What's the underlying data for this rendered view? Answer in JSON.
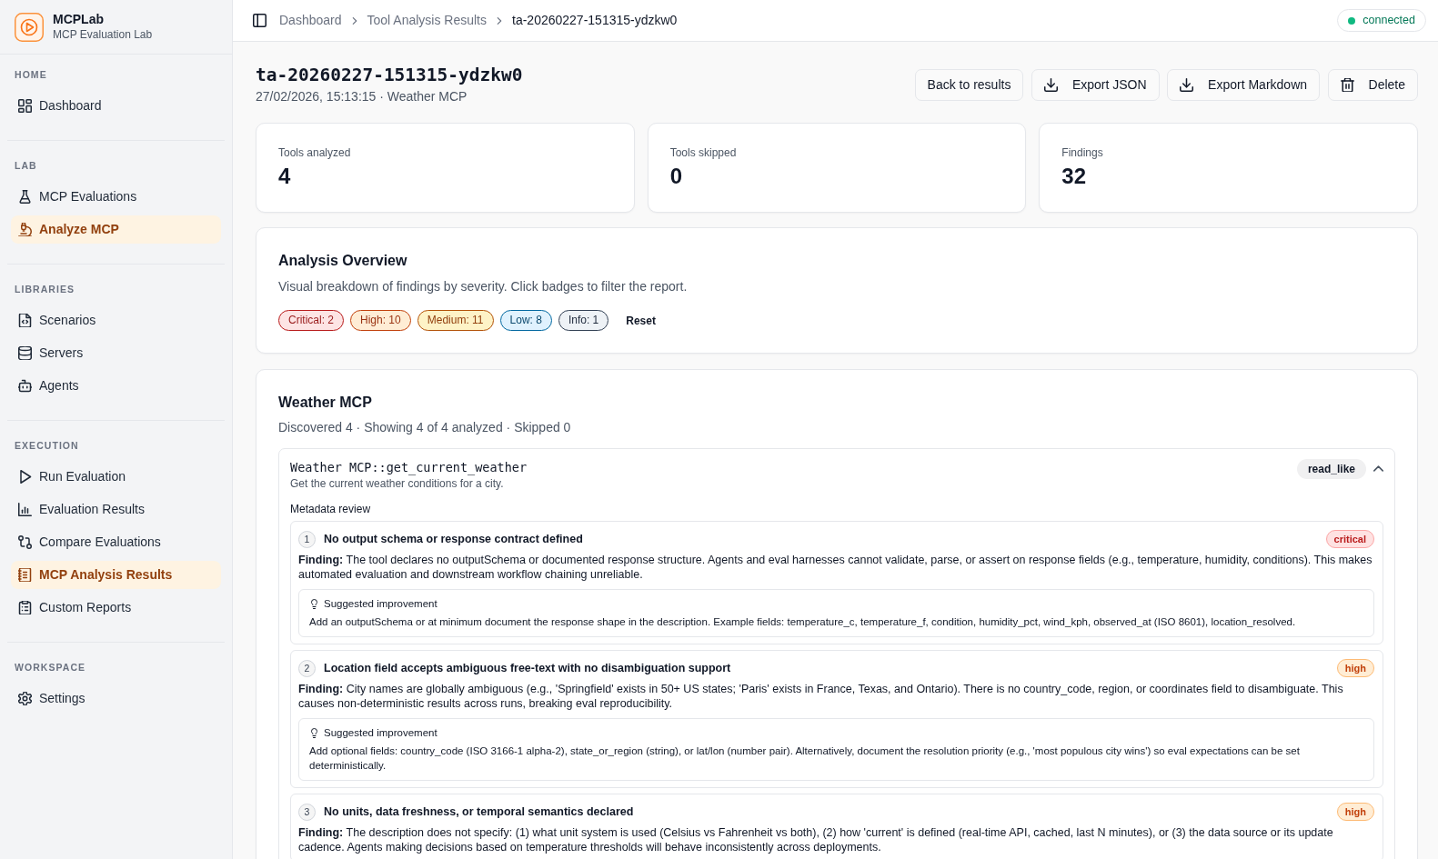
{
  "sidebar": {
    "brand": {
      "name": "MCPLab",
      "subtitle": "MCP Evaluation Lab"
    },
    "sections": [
      {
        "title": "HOME",
        "items": [
          {
            "label": "Dashboard",
            "selected": false
          }
        ]
      },
      {
        "title": "LAB",
        "items": [
          {
            "label": "MCP Evaluations",
            "selected": false
          },
          {
            "label": "Analyze MCP",
            "selected": true
          }
        ]
      },
      {
        "title": "LIBRARIES",
        "items": [
          {
            "label": "Scenarios",
            "selected": false
          },
          {
            "label": "Servers",
            "selected": false
          },
          {
            "label": "Agents",
            "selected": false
          }
        ]
      },
      {
        "title": "EXECUTION",
        "items": [
          {
            "label": "Run Evaluation",
            "selected": false
          },
          {
            "label": "Evaluation Results",
            "selected": false
          },
          {
            "label": "Compare Evaluations",
            "selected": false
          },
          {
            "label": "MCP Analysis Results",
            "selected": true
          },
          {
            "label": "Custom Reports",
            "selected": false
          }
        ]
      },
      {
        "title": "WORKSPACE",
        "items": [
          {
            "label": "Settings",
            "selected": false
          }
        ]
      }
    ]
  },
  "header": {
    "breadcrumbs": [
      {
        "label": "Dashboard",
        "current": false
      },
      {
        "label": "Tool Analysis Results",
        "current": false
      },
      {
        "label": "ta-20260227-151315-ydzkw0",
        "current": true
      }
    ],
    "status": {
      "label": "connected",
      "color": "#10b981"
    }
  },
  "page": {
    "title": "ta-20260227-151315-ydzkw0",
    "subtitle": "27/02/2026, 15:13:15 · Weather MCP",
    "actions": [
      {
        "label": "Back to results"
      },
      {
        "label": "Export JSON"
      },
      {
        "label": "Export Markdown"
      },
      {
        "label": "Delete"
      }
    ]
  },
  "stats": [
    {
      "label": "Tools analyzed",
      "value": "4"
    },
    {
      "label": "Tools skipped",
      "value": "0"
    },
    {
      "label": "Findings",
      "value": "32"
    }
  ],
  "overview": {
    "title": "Analysis Overview",
    "description": "Visual breakdown of findings by severity. Click badges to filter the report.",
    "filters": [
      {
        "label": "Critical: 2",
        "kind": "critical"
      },
      {
        "label": "High: 10",
        "kind": "high"
      },
      {
        "label": "Medium: 11",
        "kind": "medium"
      },
      {
        "label": "Low: 8",
        "kind": "low"
      },
      {
        "label": "Info: 1",
        "kind": "info"
      }
    ],
    "reset": "Reset"
  },
  "server": {
    "title": "Weather MCP",
    "summary": "Discovered 4 · Showing 4 of 4 analyzed · Skipped 0",
    "tools": [
      {
        "name": "Weather MCP::get_current_weather",
        "description": "Get the current weather conditions for a city.",
        "tag": "read_like",
        "expanded": true,
        "review_title": "Metadata review",
        "findings": [
          {
            "number": "1",
            "title": "No output schema or response contract defined",
            "badge": "critical",
            "kind": "critical",
            "text": "**Finding:** The tool declares no outputSchema or documented response structure. Agents and eval harnesses cannot validate, parse, or assert on response fields (e.g., temperature, humidity, conditions). This makes automated evaluation and downstream workflow chaining unreliable.",
            "suggestion": {
              "title": "Suggested improvement",
              "text": "Add an outputSchema or at minimum document the response shape in the description. Example fields: temperature_c, temperature_f, condition, humidity_pct, wind_kph, observed_at (ISO 8601), location_resolved."
            }
          },
          {
            "number": "2",
            "title": "Location field accepts ambiguous free-text with no disambiguation support",
            "badge": "high",
            "kind": "high",
            "text": "**Finding:** City names are globally ambiguous (e.g., 'Springfield' exists in 50+ US states; 'Paris' exists in France, Texas, and Ontario). There is no country_code, region, or coordinates field to disambiguate. This causes non-deterministic results across runs, breaking eval reproducibility.",
            "suggestion": {
              "title": "Suggested improvement",
              "text": "Add optional fields: country_code (ISO 3166-1 alpha-2), state_or_region (string), or lat/lon (number pair). Alternatively, document the resolution priority (e.g., 'most populous city wins') so eval expectations can be set deterministically."
            }
          },
          {
            "number": "3",
            "title": "No units, data freshness, or temporal semantics declared",
            "badge": "high",
            "kind": "high",
            "text": "**Finding:** The description does not specify: (1) what unit system is used (Celsius vs Fahrenheit vs both), (2) how 'current' is defined (real-time API, cached, last N minutes), or (3) the data source or its update cadence. Agents making decisions based on temperature thresholds will behave inconsistently across deployments."
          }
        ]
      }
    ]
  }
}
